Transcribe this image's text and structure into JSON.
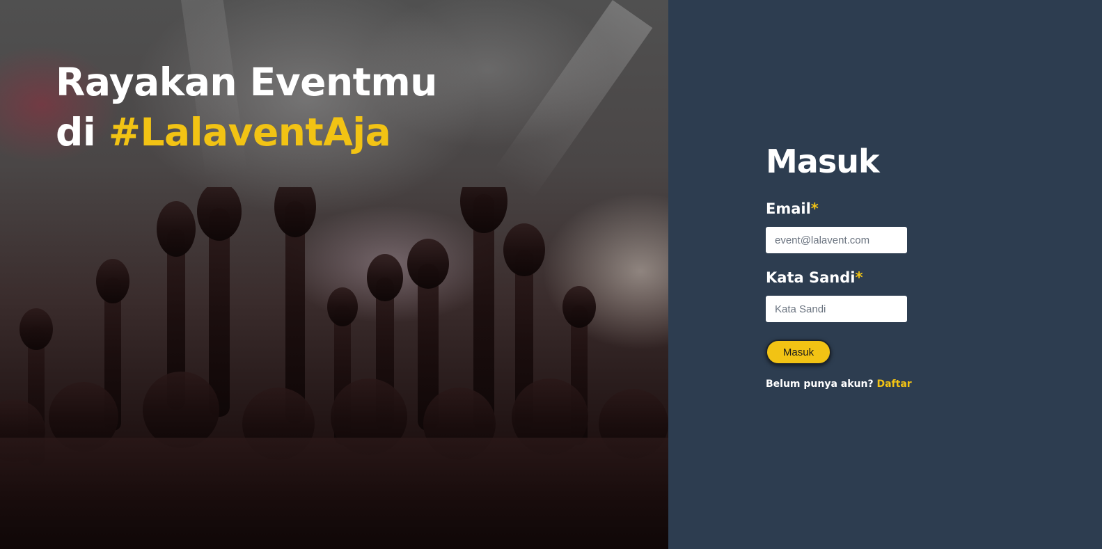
{
  "hero": {
    "title_line1": "Rayakan Eventmu",
    "title_prefix": "di ",
    "title_hashtag": "#LalaventAja",
    "image": "concert-crowd-raised-hands"
  },
  "login": {
    "title": "Masuk",
    "email_label": "Email",
    "email_required": "*",
    "email_placeholder": "event@lalavent.com",
    "password_label": "Kata Sandi",
    "password_required": "*",
    "password_placeholder": "Kata Sandi",
    "submit_label": "Masuk",
    "signup_prompt": "Belum punya akun?",
    "signup_link": "Daftar"
  },
  "colors": {
    "accent": "#f2c314",
    "panel_background": "#2d3d50",
    "text": "#ffffff"
  }
}
